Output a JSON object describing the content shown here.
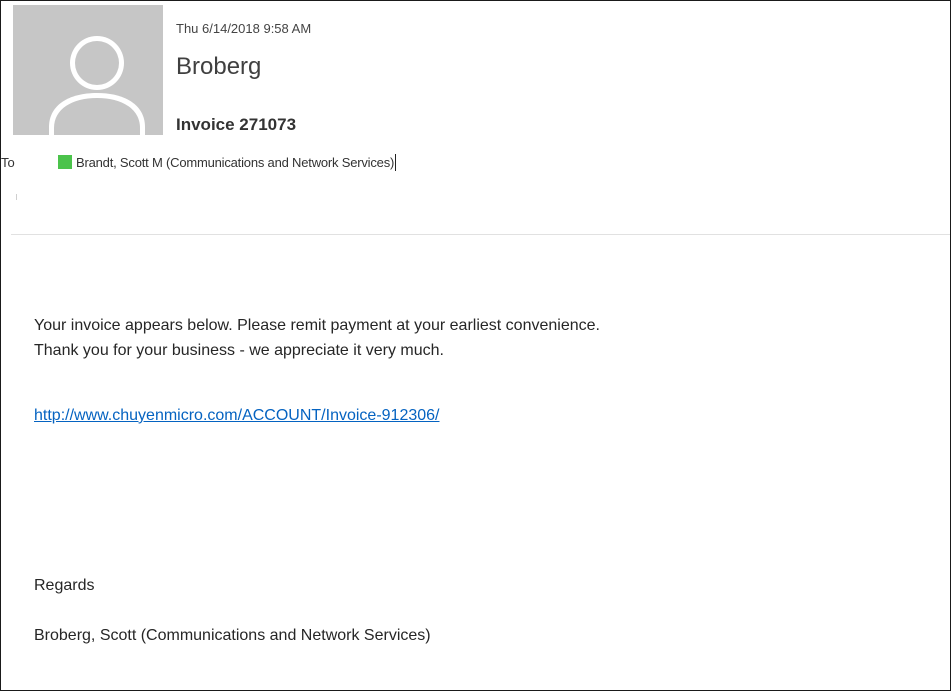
{
  "message": {
    "timestamp": "Thu 6/14/2018 9:58 AM",
    "sender": "Broberg",
    "subject": "Invoice 271073",
    "to_label": "To",
    "recipient": "Brandt, Scott M (Communications and Network Services)",
    "presence_color": "#4bc34b",
    "avatar_icon": "person-silhouette-icon"
  },
  "body": {
    "line1": "Your invoice appears below. Please remit payment at your earliest convenience.",
    "line2": "Thank you for your business - we appreciate it very much.",
    "link": "http://www.chuyenmicro.com/ACCOUNT/Invoice-912306/",
    "regards": "Regards",
    "signature": "Broberg, Scott (Communications and Network Services)"
  },
  "colors": {
    "link": "#0563c1",
    "avatar_bg": "#c6c6c6"
  }
}
